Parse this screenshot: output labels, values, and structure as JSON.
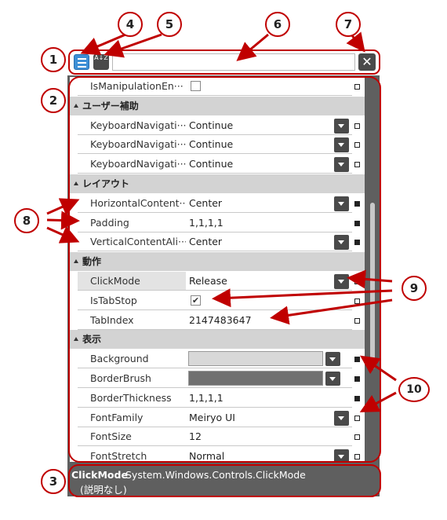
{
  "toolbar": {
    "categorized_icon": "categorized-list-icon",
    "alpha_icon": "sort-alphabetical-icon",
    "alpha_label": "A↓Z",
    "search_value": "",
    "search_placeholder": "",
    "clear_label": "✕"
  },
  "grid": {
    "rows": [
      {
        "type": "prop",
        "name": "IsManipulationEn···",
        "kind": "check",
        "value": "",
        "checked": false,
        "marker": "empty"
      },
      {
        "type": "cat",
        "name": "ユーザー補助"
      },
      {
        "type": "prop",
        "name": "KeyboardNavigati···",
        "kind": "dropdown",
        "value": "Continue",
        "marker": "empty"
      },
      {
        "type": "prop",
        "name": "KeyboardNavigati···",
        "kind": "dropdown",
        "value": "Continue",
        "marker": "empty"
      },
      {
        "type": "prop",
        "name": "KeyboardNavigati···",
        "kind": "dropdown",
        "value": "Continue",
        "marker": "empty"
      },
      {
        "type": "cat",
        "name": "レイアウト"
      },
      {
        "type": "prop",
        "name": "HorizontalContent···",
        "kind": "dropdown",
        "value": "Center",
        "marker": "filled"
      },
      {
        "type": "prop",
        "name": "Padding",
        "kind": "text",
        "value": "1,1,1,1",
        "marker": "filled"
      },
      {
        "type": "prop",
        "name": "VerticalContentAli···",
        "kind": "dropdown",
        "value": "Center",
        "marker": "filled"
      },
      {
        "type": "cat",
        "name": "動作"
      },
      {
        "type": "prop",
        "name": "ClickMode",
        "kind": "dropdown",
        "value": "Release",
        "marker": "empty",
        "selected": true
      },
      {
        "type": "prop",
        "name": "IsTabStop",
        "kind": "check",
        "value": "✔",
        "checked": true,
        "marker": "empty"
      },
      {
        "type": "prop",
        "name": "TabIndex",
        "kind": "text",
        "value": "2147483647",
        "marker": "empty"
      },
      {
        "type": "cat",
        "name": "表示"
      },
      {
        "type": "prop",
        "name": "Background",
        "kind": "color",
        "value": "",
        "color": "#d8d8d8",
        "marker": "filled"
      },
      {
        "type": "prop",
        "name": "BorderBrush",
        "kind": "color",
        "value": "",
        "color": "#707070",
        "marker": "filled"
      },
      {
        "type": "prop",
        "name": "BorderThickness",
        "kind": "text",
        "value": "1,1,1,1",
        "marker": "filled"
      },
      {
        "type": "prop",
        "name": "FontFamily",
        "kind": "dropdown",
        "value": "Meiryo UI",
        "marker": "empty"
      },
      {
        "type": "prop",
        "name": "FontSize",
        "kind": "text",
        "value": "12",
        "marker": "empty"
      },
      {
        "type": "prop",
        "name": "FontStretch",
        "kind": "dropdown",
        "value": "Normal",
        "marker": "empty"
      }
    ]
  },
  "description": {
    "name": "ClickMode",
    "type": "System.Windows.Controls.ClickMode",
    "text": "(説明なし)"
  },
  "callouts": [
    "1",
    "2",
    "3",
    "4",
    "5",
    "6",
    "7",
    "8",
    "9",
    "10"
  ],
  "colors": {
    "annotation": "#c00000",
    "accent": "#3d8fd6",
    "panel": "#5f5f5f"
  }
}
